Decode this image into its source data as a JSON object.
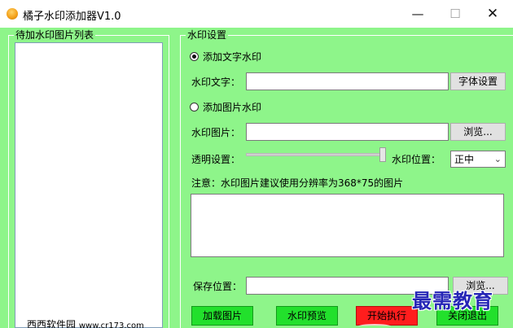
{
  "window": {
    "title": "橘子水印添加器V1.0",
    "minimize": "—",
    "maximize": "☐",
    "close": "✕"
  },
  "left_panel": {
    "title": "待加水印图片列表",
    "footer_main": "西西软件园",
    "footer_url": "www.cr173.com"
  },
  "settings": {
    "title": "水印设置",
    "text_radio_label": "添加文字水印",
    "text_label": "水印文字：",
    "text_value": "",
    "font_button": "字体设置",
    "image_radio_label": "添加图片水印",
    "image_label": "水印图片：",
    "image_value": "",
    "browse_button": "浏览...",
    "opacity_label": "透明设置：",
    "opacity_value": 1.0,
    "position_label": "水印位置：",
    "position_value": "正中",
    "note": "注意：水印图片建议使用分辨率为368*75的图片",
    "notes_value": "",
    "save_label": "保存位置：",
    "save_value": "",
    "save_browse_button": "浏览..."
  },
  "actions": {
    "load": "加载图片",
    "preview": "水印预览",
    "start": "开始执行",
    "close": "关闭退出"
  },
  "overlay_watermark": "最需教育",
  "colors": {
    "client_bg": "#8ef58a",
    "green_button": "#22e02c",
    "red_button": "#ff1d1d",
    "watermark": "#2626b6"
  }
}
